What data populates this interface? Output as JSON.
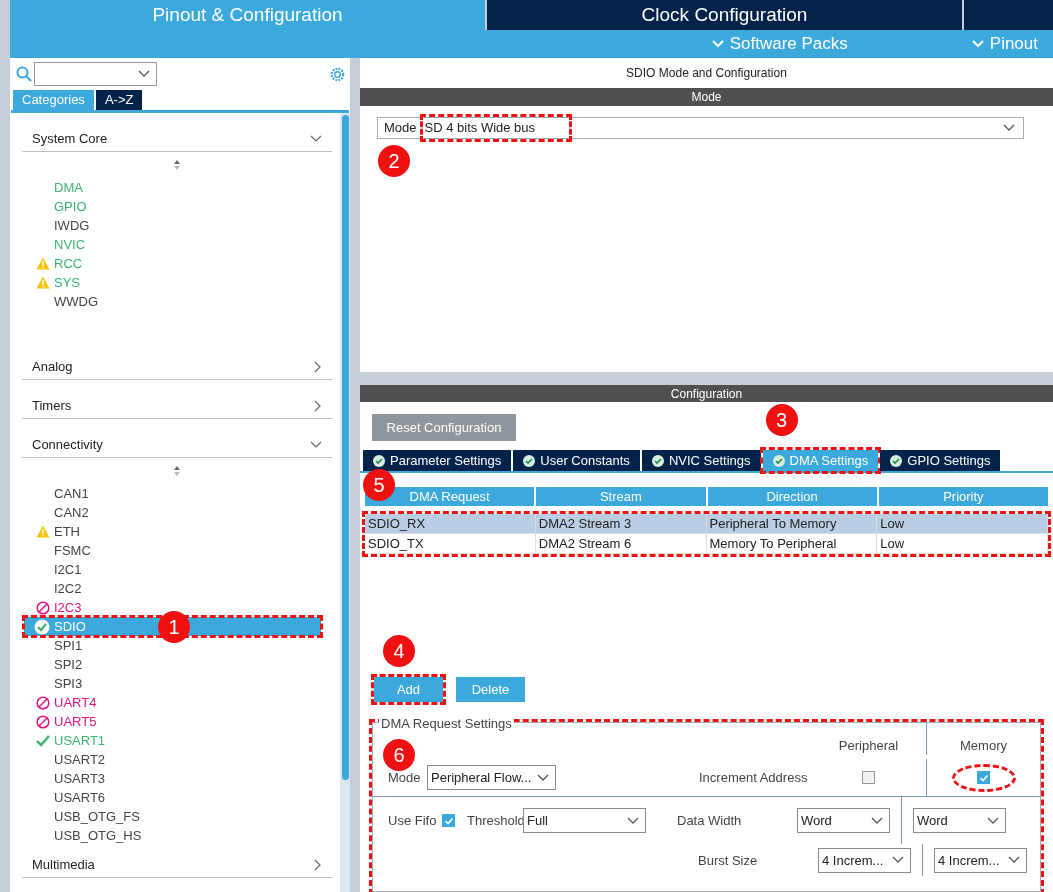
{
  "top_tabs": [
    {
      "label": "Pinout & Configuration",
      "selected": true
    },
    {
      "label": "Clock Configuration",
      "selected": false
    }
  ],
  "sub_menu": [
    "Software Packs",
    "Pinout"
  ],
  "sidebar": {
    "view_tabs": [
      {
        "label": "Categories",
        "selected": true
      },
      {
        "label": "A->Z",
        "selected": false
      }
    ],
    "categories": [
      {
        "label": "System Core",
        "expanded": true,
        "items": [
          {
            "label": "DMA",
            "kind": "active",
            "selected": false
          },
          {
            "label": "GPIO",
            "kind": "active",
            "selected": false
          },
          {
            "label": "IWDG",
            "kind": "idle",
            "selected": false
          },
          {
            "label": "NVIC",
            "kind": "active",
            "selected": false
          },
          {
            "label": "RCC",
            "kind": "warned",
            "selected": false
          },
          {
            "label": "SYS",
            "kind": "warned",
            "selected": false
          },
          {
            "label": "WWDG",
            "kind": "idle",
            "selected": false
          }
        ]
      },
      {
        "label": "Analog",
        "expanded": false
      },
      {
        "label": "Timers",
        "expanded": false
      },
      {
        "label": "Connectivity",
        "expanded": true,
        "items": [
          {
            "label": "CAN1",
            "kind": "idle",
            "selected": false
          },
          {
            "label": "CAN2",
            "kind": "idle",
            "selected": false
          },
          {
            "label": "ETH",
            "kind": "flagged",
            "selected": false
          },
          {
            "label": "FSMC",
            "kind": "idle",
            "selected": false
          },
          {
            "label": "I2C1",
            "kind": "idle",
            "selected": false
          },
          {
            "label": "I2C2",
            "kind": "idle",
            "selected": false
          },
          {
            "label": "I2C3",
            "kind": "conflict",
            "selected": false
          },
          {
            "label": "SDIO",
            "kind": "enabled",
            "selected": true,
            "badge": "1"
          },
          {
            "label": "SPI1",
            "kind": "idle",
            "selected": false
          },
          {
            "label": "SPI2",
            "kind": "idle",
            "selected": false
          },
          {
            "label": "SPI3",
            "kind": "idle",
            "selected": false
          },
          {
            "label": "UART4",
            "kind": "conflict",
            "selected": false
          },
          {
            "label": "UART5",
            "kind": "conflict",
            "selected": false
          },
          {
            "label": "USART1",
            "kind": "enabled",
            "selected": false
          },
          {
            "label": "USART2",
            "kind": "idle",
            "selected": false
          },
          {
            "label": "USART3",
            "kind": "idle",
            "selected": false
          },
          {
            "label": "USART6",
            "kind": "idle",
            "selected": false
          },
          {
            "label": "USB_OTG_FS",
            "kind": "idle",
            "selected": false
          },
          {
            "label": "USB_OTG_HS",
            "kind": "idle",
            "selected": false
          }
        ]
      },
      {
        "label": "Multimedia",
        "expanded": false
      }
    ]
  },
  "panel_title": "SDIO Mode and Configuration",
  "mode_section": {
    "title": "Mode",
    "label": "Mode",
    "value": "SD 4 bits Wide bus",
    "badge": "2"
  },
  "configuration": {
    "title": "Configuration",
    "reset_button": "Reset Configuration",
    "tabs": [
      {
        "label": "Parameter Settings",
        "selected": false
      },
      {
        "label": "User Constants",
        "selected": false
      },
      {
        "label": "NVIC Settings",
        "selected": false
      },
      {
        "label": "DMA Settings",
        "selected": true,
        "badge": "3"
      },
      {
        "label": "GPIO Settings",
        "selected": false
      }
    ],
    "table": {
      "badge": "5",
      "columns": [
        "DMA Request",
        "Stream",
        "Direction",
        "Priority"
      ],
      "rows": [
        {
          "cells": [
            "SDIO_RX",
            "DMA2 Stream 3",
            "Peripheral To Memory",
            "Low"
          ],
          "selected": true
        },
        {
          "cells": [
            "SDIO_TX",
            "DMA2 Stream 6",
            "Memory To Peripheral",
            "Low"
          ],
          "selected": false
        }
      ]
    },
    "buttons": [
      {
        "label": "Add",
        "badge": "4"
      },
      {
        "label": "Delete"
      }
    ],
    "request_settings": {
      "title": "DMA Request Settings",
      "badge": "6",
      "peripheral_header": "Peripheral",
      "memory_header": "Memory",
      "mode_label": "Mode",
      "mode_value": "Peripheral Flow...",
      "increment_label": "Increment Address",
      "peripheral_increment": false,
      "memory_increment": true,
      "use_fifo_label": "Use Fifo",
      "use_fifo": true,
      "threshold_label": "Threshold",
      "threshold_value": "Full",
      "data_width_label": "Data Width",
      "peripheral_data_width": "Word",
      "memory_data_width": "Word",
      "burst_size_label": "Burst Size",
      "peripheral_burst_size": "4 Increm...",
      "memory_burst_size": "4 Increm..."
    }
  }
}
